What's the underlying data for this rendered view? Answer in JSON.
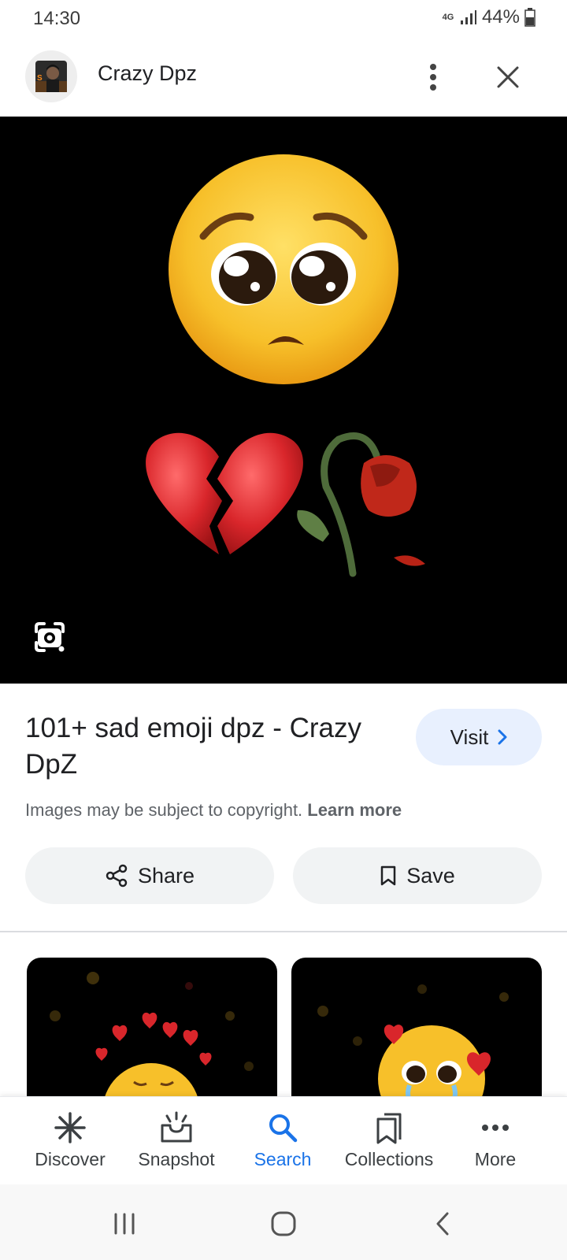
{
  "status_bar": {
    "time": "14:30",
    "network": "4G",
    "battery": "44%"
  },
  "header": {
    "title": "Crazy Dpz",
    "avatar_icon": "site-avatar",
    "menu_icon": "more-vert-icon",
    "close_icon": "close-icon"
  },
  "result": {
    "title": "101+ sad emoji dpz - Crazy DpZ",
    "visit_label": "Visit",
    "copyright_text": "Images may be subject to copyright.",
    "learn_more": "Learn more"
  },
  "actions": {
    "share_label": "Share",
    "save_label": "Save"
  },
  "bottom_nav": {
    "items": [
      {
        "label": "Discover",
        "icon": "asterisk-icon",
        "active": false
      },
      {
        "label": "Snapshot",
        "icon": "snapshot-icon",
        "active": false
      },
      {
        "label": "Search",
        "icon": "search-icon",
        "active": true
      },
      {
        "label": "Collections",
        "icon": "collections-icon",
        "active": false
      },
      {
        "label": "More",
        "icon": "more-horiz-icon",
        "active": false
      }
    ]
  },
  "colors": {
    "accent": "#1a73e8",
    "visit_bg": "#e8f0fe",
    "button_bg": "#f1f3f4",
    "emoji_yellow": "#f7c02a",
    "heart_red": "#d9262b"
  }
}
